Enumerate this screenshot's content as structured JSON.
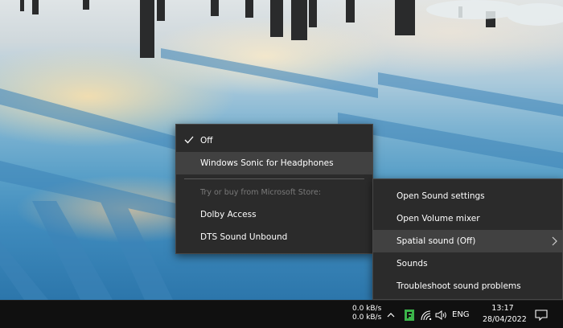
{
  "spatial_menu": {
    "items": [
      {
        "label": "Off",
        "checked": true
      },
      {
        "label": "Windows Sonic for Headphones",
        "highlighted": true
      }
    ],
    "store_heading": "Try or buy from Microsoft Store:",
    "store_items": [
      {
        "label": "Dolby Access"
      },
      {
        "label": "DTS Sound Unbound"
      }
    ]
  },
  "sound_menu": {
    "items": [
      {
        "label": "Open Sound settings"
      },
      {
        "label": "Open Volume mixer"
      },
      {
        "label": "Spatial sound (Off)",
        "has_submenu": true,
        "highlighted": true
      },
      {
        "label": "Sounds"
      },
      {
        "label": "Troubleshoot sound problems"
      }
    ]
  },
  "taskbar": {
    "network_upload": "0.0 kB/s",
    "network_download": "0.0 kB/s",
    "icons": [
      "chevron-up-icon",
      "app-tray-icon",
      "wifi-icon",
      "volume-icon",
      "notification-icon"
    ],
    "language": "ENG",
    "time": "13:17",
    "date": "28/04/2022"
  },
  "colors": {
    "menu_bg": "#2b2b2b",
    "menu_highlight": "#414141",
    "taskbar_bg": "#101010",
    "tray_app_green": "#3bb54a"
  }
}
